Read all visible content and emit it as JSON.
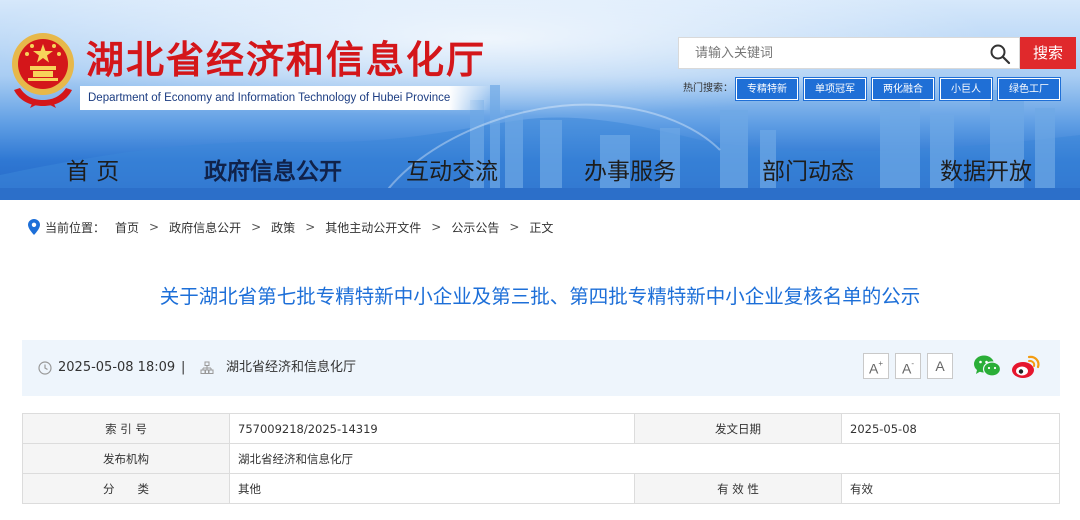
{
  "header": {
    "site_title": "湖北省经济和信息化厅",
    "site_subtitle": "Department of Economy and Information Technology of Hubei Province",
    "search": {
      "placeholder": "请输入关键词",
      "button_label": "搜索"
    },
    "hot_search": {
      "label": "热门搜索：",
      "tags": [
        "专精特新",
        "单项冠军",
        "两化融合",
        "小巨人",
        "绿色工厂"
      ]
    },
    "brand_color": "#d4161a",
    "accent_color": "#1f6fd6"
  },
  "nav": {
    "items": [
      {
        "label": "首  页",
        "active": false
      },
      {
        "label": "政府信息公开",
        "active": true
      },
      {
        "label": "互动交流",
        "active": false
      },
      {
        "label": "办事服务",
        "active": false
      },
      {
        "label": "部门动态",
        "active": false
      },
      {
        "label": "数据开放",
        "active": false
      }
    ]
  },
  "breadcrumb": {
    "label": "当前位置：",
    "items": [
      "首页",
      "政府信息公开",
      "政策",
      "其他主动公开文件",
      "公示公告",
      "正文"
    ],
    "separator": ">"
  },
  "article": {
    "title": "关于湖北省第七批专精特新中小企业及第三批、第四批专精特新中小企业复核名单的公示",
    "date": "2025-05-08 18:09",
    "divider": "|",
    "source": "湖北省经济和信息化厅",
    "font_controls": {
      "large": "A",
      "large_sup": "+",
      "small": "A",
      "small_sup": "-",
      "normal": "A"
    }
  },
  "info_table": {
    "rows": [
      {
        "label1": "索 引 号",
        "value1": "757009218/2025-14319",
        "label2": "发文日期",
        "value2": "2025-05-08"
      },
      {
        "label1": "发布机构",
        "value1": "湖北省经济和信息化厅"
      },
      {
        "label1": "分　　类",
        "value1": "其他",
        "label2": "有 效 性",
        "value2": "有效"
      }
    ]
  }
}
